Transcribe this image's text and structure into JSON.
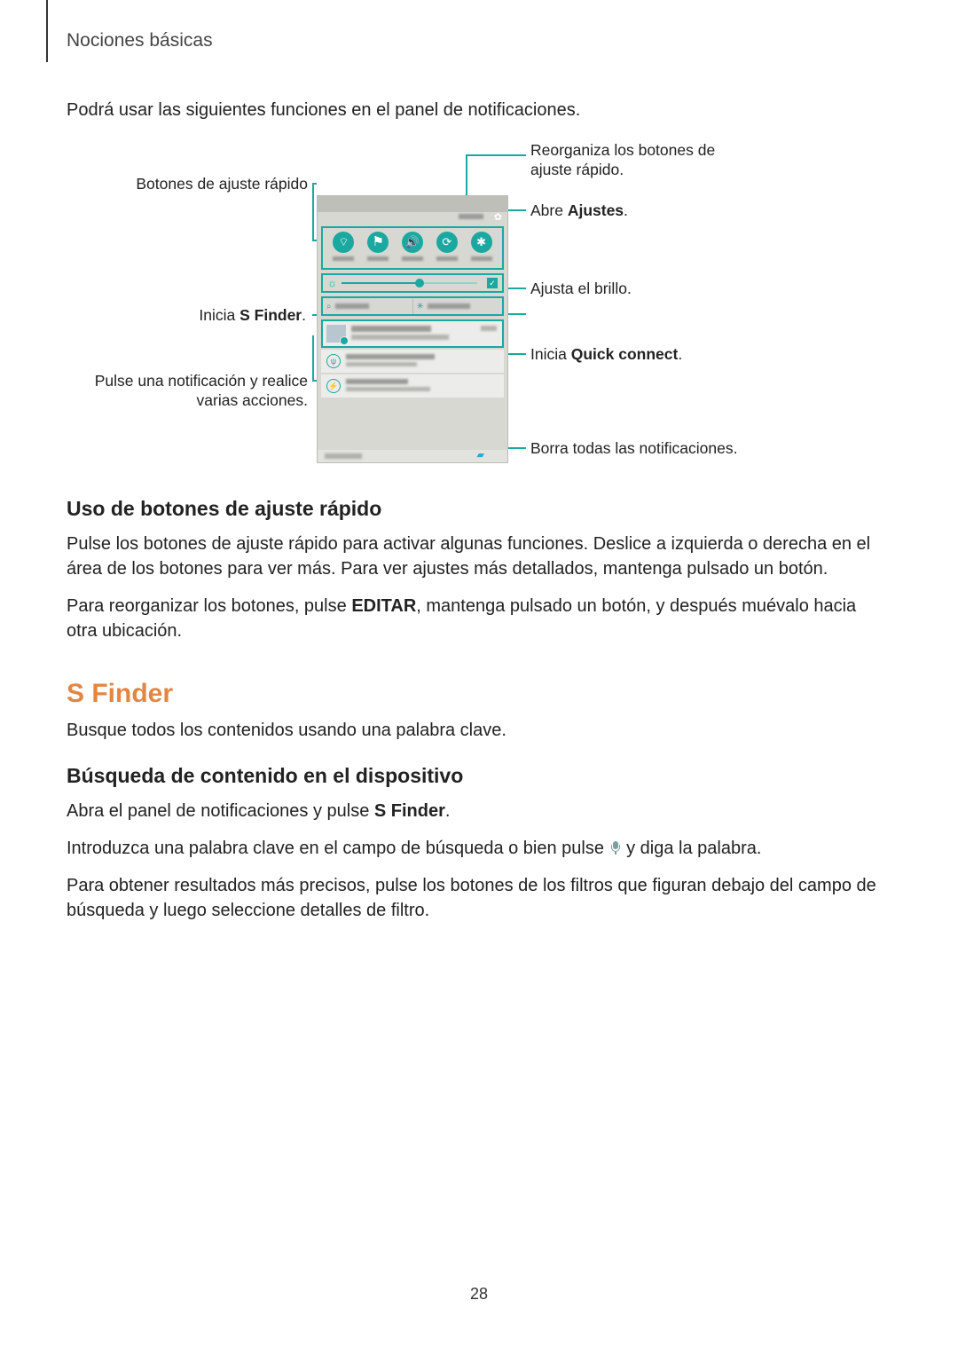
{
  "header": {
    "section": "Nociones básicas"
  },
  "intro": "Podrá usar las siguientes funciones en el panel de notificaciones.",
  "callouts": {
    "left": {
      "quick_buttons": "Botones de ajuste rápido",
      "sfinder_pre": "Inicia ",
      "sfinder_bold": "S Finder",
      "sfinder_post": ".",
      "notif_tap": "Pulse una notificación y realice varias acciones."
    },
    "right": {
      "reorganize": "Reorganiza los botones de ajuste rápido.",
      "settings_pre": "Abre ",
      "settings_bold": "Ajustes",
      "settings_post": ".",
      "brightness": "Ajusta el brillo.",
      "qc_pre": "Inicia ",
      "qc_bold": "Quick connect",
      "qc_post": ".",
      "clear": "Borra todas las notificaciones."
    }
  },
  "screenshot_ui": {
    "quick_icons": [
      "wifi",
      "location",
      "sound",
      "rotate",
      "bluetooth"
    ]
  },
  "section_quick": {
    "title": "Uso de botones de ajuste rápido",
    "p1": "Pulse los botones de ajuste rápido para activar algunas funciones. Deslice a izquierda o derecha en el área de los botones para ver más. Para ver ajustes más detallados, mantenga pulsado un botón.",
    "p2_pre": "Para reorganizar los botones, pulse ",
    "p2_bold": "EDITAR",
    "p2_post": ", mantenga pulsado un botón, y después muévalo hacia otra ubicación."
  },
  "section_sfinder": {
    "title": "S Finder",
    "p1": "Busque todos los contenidos usando una palabra clave."
  },
  "section_search": {
    "title": "Búsqueda de contenido en el dispositivo",
    "p1_pre": "Abra el panel de notificaciones y pulse ",
    "p1_bold": "S Finder",
    "p1_post": ".",
    "p2_pre": "Introduzca una palabra clave en el campo de búsqueda o bien pulse ",
    "p2_post": " y diga la palabra.",
    "p3": "Para obtener resultados más precisos, pulse los botones de los filtros que figuran debajo del campo de búsqueda y luego seleccione detalles de filtro."
  },
  "page_number": "28"
}
